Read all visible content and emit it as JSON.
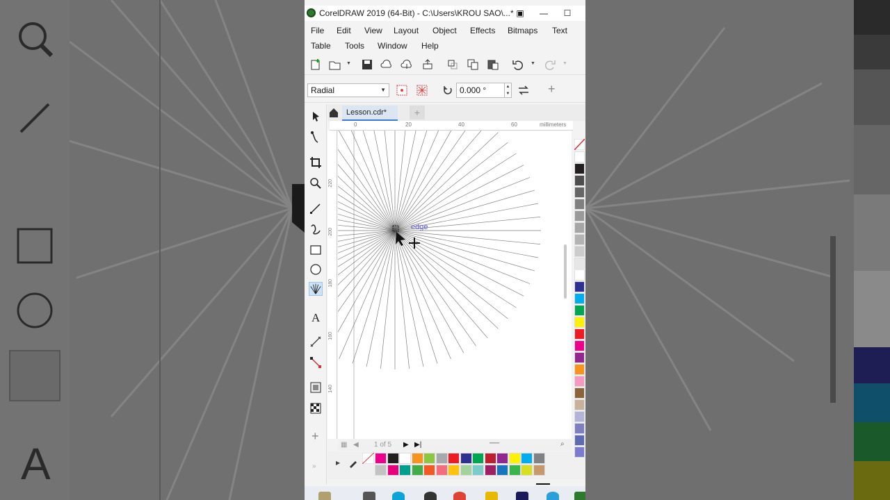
{
  "window": {
    "title": "CorelDRAW 2019 (64-Bit) - C:\\Users\\KROU SAO\\...*"
  },
  "menu": {
    "row1": [
      "File",
      "Edit",
      "View",
      "Layout",
      "Object",
      "Effects",
      "Bitmaps",
      "Text"
    ],
    "row2": [
      "Table",
      "Tools",
      "Window",
      "Help"
    ]
  },
  "property_bar": {
    "mode": "Radial",
    "angle": "0.000 °"
  },
  "document": {
    "tab": "Lesson.cdr*"
  },
  "ruler": {
    "ticks": [
      "0",
      "20",
      "40",
      "60"
    ],
    "unit": "millimeters",
    "left_ticks": [
      "220",
      "200",
      "180",
      "160",
      "140"
    ]
  },
  "canvas": {
    "tooltip": "edge",
    "rays": 64
  },
  "pagenav": {
    "text": "1 of 5"
  },
  "colors": {
    "accent": "#3b7bd6",
    "doc_palette": [
      "#ec008c",
      "#231f20",
      "#ffffff",
      "#f7941d",
      "#8dc63f",
      "#a7a9ac",
      "#ed1c24",
      "#2e3192",
      "#00a651",
      "#be1e2d",
      "#92278f",
      "#fff200",
      "#00aeef",
      "#808285",
      "#c2c2c2",
      "#e6007e",
      "#009e8e",
      "#40ad49",
      "#f15a24",
      "#f26d7d",
      "#ffc20e",
      "#a3d39c",
      "#7accc8",
      "#9e1f63",
      "#1b75bc",
      "#39b54a",
      "#d7df23",
      "#c49a6c"
    ],
    "right_palette": [
      "#ffffff",
      "#231f20",
      "#4d4d4d",
      "#666666",
      "#808080",
      "#999999",
      "#a6a6a6",
      "#b3b3b3",
      "#cccccc",
      "#e6e6e6",
      "#ffffff",
      "#2e3192",
      "#00aeef",
      "#00a651",
      "#fff200",
      "#ed1c24",
      "#ec008c",
      "#92278f",
      "#f7941d",
      "#f49ac1",
      "#8c6239",
      "#c7b299",
      "#b3b3d9",
      "#7f7fbf",
      "#5e6ab1",
      "#7c7ccf"
    ]
  }
}
